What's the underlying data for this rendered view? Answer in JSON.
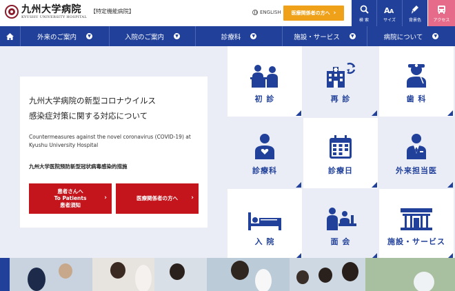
{
  "header": {
    "logo_main": "九州大学病院",
    "logo_sub": "KYUSHU UNIVERSITY HOSPITAL",
    "logo_tag": "【特定機能病院】",
    "lang_label": "ENGLISH",
    "pro_button": "医療関係者の方へ",
    "utilities": [
      {
        "label": "検 索",
        "icon": "search-icon"
      },
      {
        "label": "サイズ",
        "icon": "font-size-icon"
      },
      {
        "label": "背景色",
        "icon": "background-color-icon"
      },
      {
        "label": "アクセス",
        "icon": "bus-icon"
      }
    ]
  },
  "nav": {
    "items": [
      {
        "label": "外来のご案内"
      },
      {
        "label": "入院のご案内"
      },
      {
        "label": "診療科"
      },
      {
        "label": "施設・サービス"
      },
      {
        "label": "病院について"
      }
    ]
  },
  "hero": {
    "title_line1": "九州大学病院の新型コロナウイルス",
    "title_line2": "感染症対策に関する対応について",
    "english": "Countermeasures against the novel coronavirus (COVID-19) at Kyushu University Hospital",
    "chinese": "九州大学医院预防新型冠状病毒感染的措施",
    "btn_patients_line1": "患者さんへ",
    "btn_patients_line2": "To Patients",
    "btn_patients_line3": "患者須知",
    "btn_pros": "医療関係者の方へ"
  },
  "tiles": [
    {
      "label": "初 診",
      "icon": "first-visit-icon"
    },
    {
      "label": "再 診",
      "icon": "revisit-icon"
    },
    {
      "label": "歯 科",
      "icon": "dentistry-icon"
    },
    {
      "label": "診療科",
      "icon": "department-icon"
    },
    {
      "label": "診療日",
      "icon": "calendar-icon"
    },
    {
      "label": "外来担当医",
      "icon": "doctor-icon"
    },
    {
      "label": "入 院",
      "icon": "hospital-bed-icon"
    },
    {
      "label": "面 会",
      "icon": "visit-icon"
    },
    {
      "label": "施設・サービス",
      "icon": "facility-icon"
    }
  ],
  "colors": {
    "brand_blue": "#20409a",
    "accent_orange": "#f0a11a",
    "access_pink": "#e66b8a",
    "red_button": "#c4151c"
  }
}
